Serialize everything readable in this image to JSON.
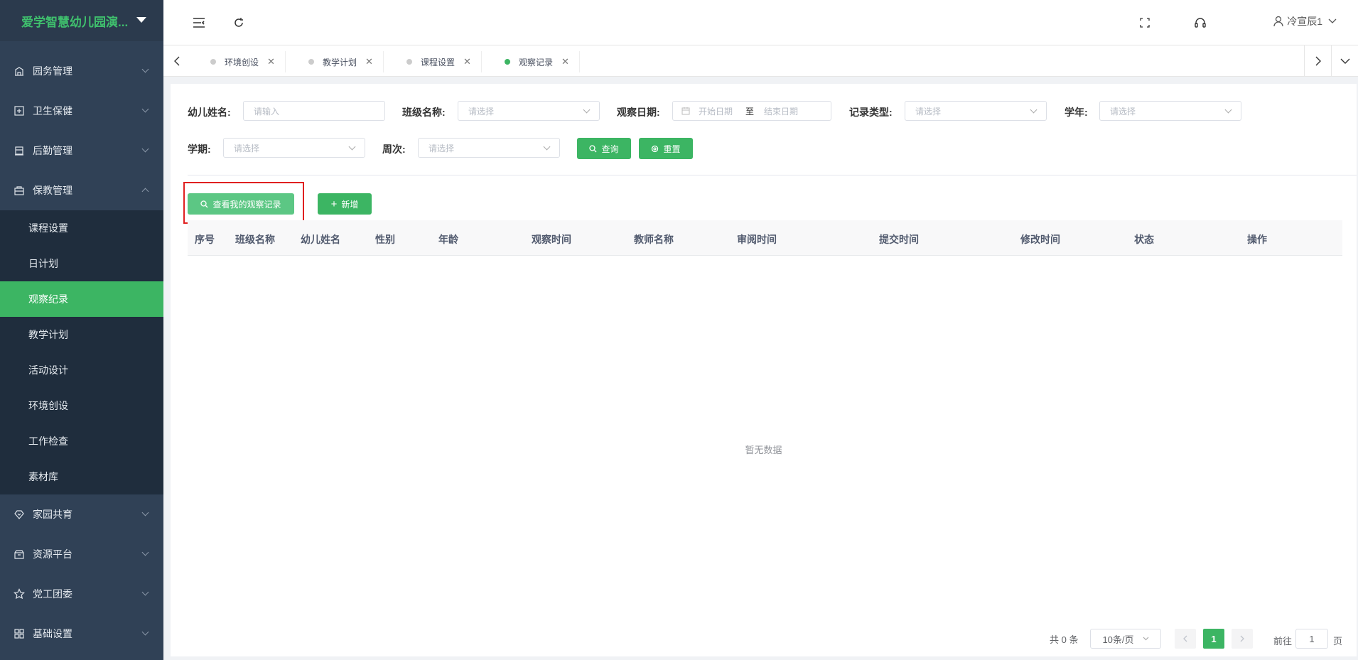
{
  "sidebar": {
    "brand": "爱学智慧幼儿园演...",
    "items": [
      {
        "label": "园务管理",
        "icon": "building-icon"
      },
      {
        "label": "卫生保健",
        "icon": "health-icon"
      },
      {
        "label": "后勤管理",
        "icon": "logistics-icon"
      },
      {
        "label": "保教管理",
        "icon": "education-icon"
      }
    ],
    "subitems": [
      "课程设置",
      "日计划",
      "观察纪录",
      "教学计划",
      "活动设计",
      "环境创设",
      "工作检查",
      "素材库"
    ],
    "active_subitem": "观察纪录",
    "items_after": [
      {
        "label": "家园共育",
        "icon": "heart-shield-icon"
      },
      {
        "label": "资源平台",
        "icon": "package-icon"
      },
      {
        "label": "党工团委",
        "icon": "star-icon"
      },
      {
        "label": "基础设置",
        "icon": "grid-icon"
      }
    ]
  },
  "header": {
    "user_name": "冷宣辰1"
  },
  "tabs": [
    {
      "label": "环境创设",
      "active": false
    },
    {
      "label": "教学计划",
      "active": false
    },
    {
      "label": "课程设置",
      "active": false
    },
    {
      "label": "观察记录",
      "active": true
    }
  ],
  "filters": {
    "child_name_label": "幼儿姓名:",
    "child_name_placeholder": "请输入",
    "class_label": "班级名称:",
    "class_placeholder": "请选择",
    "date_label": "观察日期:",
    "date_start_placeholder": "开始日期",
    "date_sep": "至",
    "date_end_placeholder": "结束日期",
    "record_type_label": "记录类型:",
    "record_type_placeholder": "请选择",
    "year_label": "学年:",
    "year_placeholder": "请选择",
    "term_label": "学期:",
    "term_placeholder": "请选择",
    "week_label": "周次:",
    "week_placeholder": "请选择",
    "query_button": "查询",
    "reset_button": "重置"
  },
  "actions": {
    "my_records_button": "查看我的观察记录",
    "add_button": "新增"
  },
  "table": {
    "columns": [
      "序号",
      "班级名称",
      "幼儿姓名",
      "性别",
      "年龄",
      "观察时间",
      "教师名称",
      "审阅时间",
      "提交时间",
      "修改时间",
      "状态",
      "操作"
    ],
    "rows": [],
    "empty_text": "暂无数据"
  },
  "pagination": {
    "total_text": "共 0 条",
    "page_size": "10条/页",
    "current_page": "1",
    "goto_label": "前往",
    "goto_value": "1",
    "page_suffix": "页"
  },
  "colors": {
    "accent": "#3cb563",
    "sidebar_bg": "#304156",
    "highlight_border": "#e02020"
  }
}
